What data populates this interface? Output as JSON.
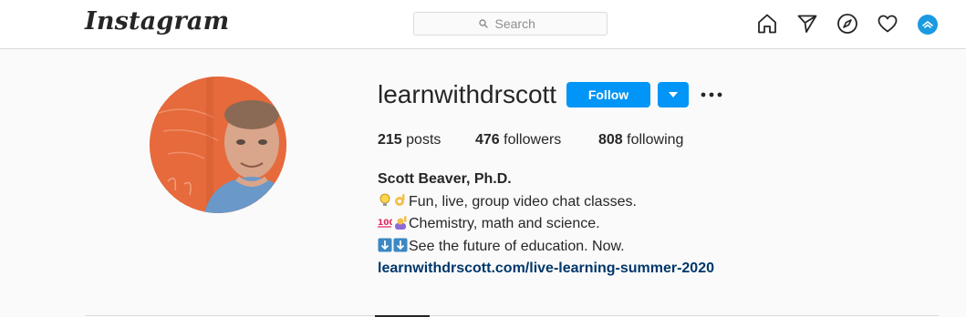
{
  "header": {
    "logo": "Instagram",
    "search_placeholder": "Search",
    "nav_icons": [
      "home-icon",
      "direct-icon",
      "explore-icon",
      "activity-icon",
      "profile-avatar"
    ]
  },
  "profile": {
    "username": "learnwithdrscott",
    "follow_label": "Follow",
    "stats": {
      "posts_count": "215",
      "posts_label": "posts",
      "followers_count": "476",
      "followers_label": "followers",
      "following_count": "808",
      "following_label": "following"
    },
    "bio": {
      "name": "Scott Beaver, Ph.D.",
      "line1": "Fun, live, group video chat classes.",
      "line2": "Chemistry, math and science.",
      "line3": "See the future of education. Now.",
      "link": "learnwithdrscott.com/live-learning-summer-2020"
    }
  },
  "colors": {
    "accent": "#0095f6",
    "link": "#00376b",
    "text": "#262626",
    "border": "#dbdbdb",
    "avatar_bg": "#e8683a"
  }
}
